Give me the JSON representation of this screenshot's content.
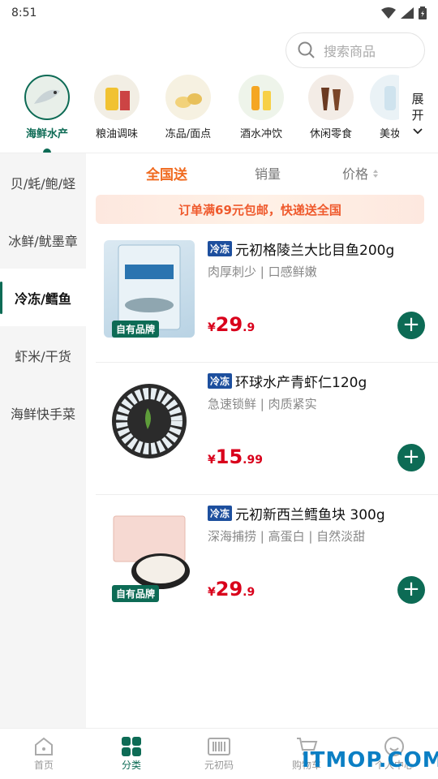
{
  "status": {
    "time": "8:51"
  },
  "search": {
    "placeholder": "搜索商品"
  },
  "categories": [
    {
      "label": "海鲜水产",
      "active": true,
      "icon": "seafood-icon"
    },
    {
      "label": "粮油调味",
      "active": false,
      "icon": "oil-icon"
    },
    {
      "label": "冻品/面点",
      "active": false,
      "icon": "frozen-food-icon"
    },
    {
      "label": "酒水冲饮",
      "active": false,
      "icon": "drinks-icon"
    },
    {
      "label": "休闲零食",
      "active": false,
      "icon": "snack-icon"
    },
    {
      "label": "美妆",
      "active": false,
      "icon": "beauty-icon"
    }
  ],
  "expand_label": "展开",
  "sidebar": {
    "items": [
      "贝/蚝/鲍/蛏",
      "冰鲜/鱿墨章",
      "冷冻/鳕鱼",
      "虾米/干货",
      "海鲜快手菜"
    ],
    "active_index": 2
  },
  "sort": {
    "nationwide": "全国送",
    "sales": "销量",
    "price": "价格"
  },
  "banner": "订单满69元包邮，快递送全国",
  "products": [
    {
      "tag": "冷冻",
      "title": "元初格陵兰大比目鱼200g",
      "subtitle": "肉厚刺少 | 口感鲜嫩",
      "currency": "¥",
      "price_int": "29",
      "price_dec": ".9",
      "brand_badge": "自有品牌"
    },
    {
      "tag": "冷冻",
      "title": "环球水产青虾仁120g",
      "subtitle": "急速锁鲜 | 肉质紧实",
      "currency": "¥",
      "price_int": "15",
      "price_dec": ".99",
      "brand_badge": ""
    },
    {
      "tag": "冷冻",
      "title": "元初新西兰鳕鱼块 300g",
      "subtitle": "深海捕捞 | 高蛋白 | 自然淡甜",
      "currency": "¥",
      "price_int": "29",
      "price_dec": ".9",
      "brand_badge": "自有品牌"
    }
  ],
  "tabs": [
    {
      "label": "首页",
      "active": false
    },
    {
      "label": "分类",
      "active": true
    },
    {
      "label": "元初码",
      "active": false
    },
    {
      "label": "购物车",
      "active": false
    },
    {
      "label": "个人中心",
      "active": false
    }
  ],
  "watermark": "ITMOP.COM",
  "colors": {
    "primary": "#0d6b55",
    "accent": "#f06a1f",
    "price": "#d9001b",
    "tag": "#1d4f9e"
  }
}
